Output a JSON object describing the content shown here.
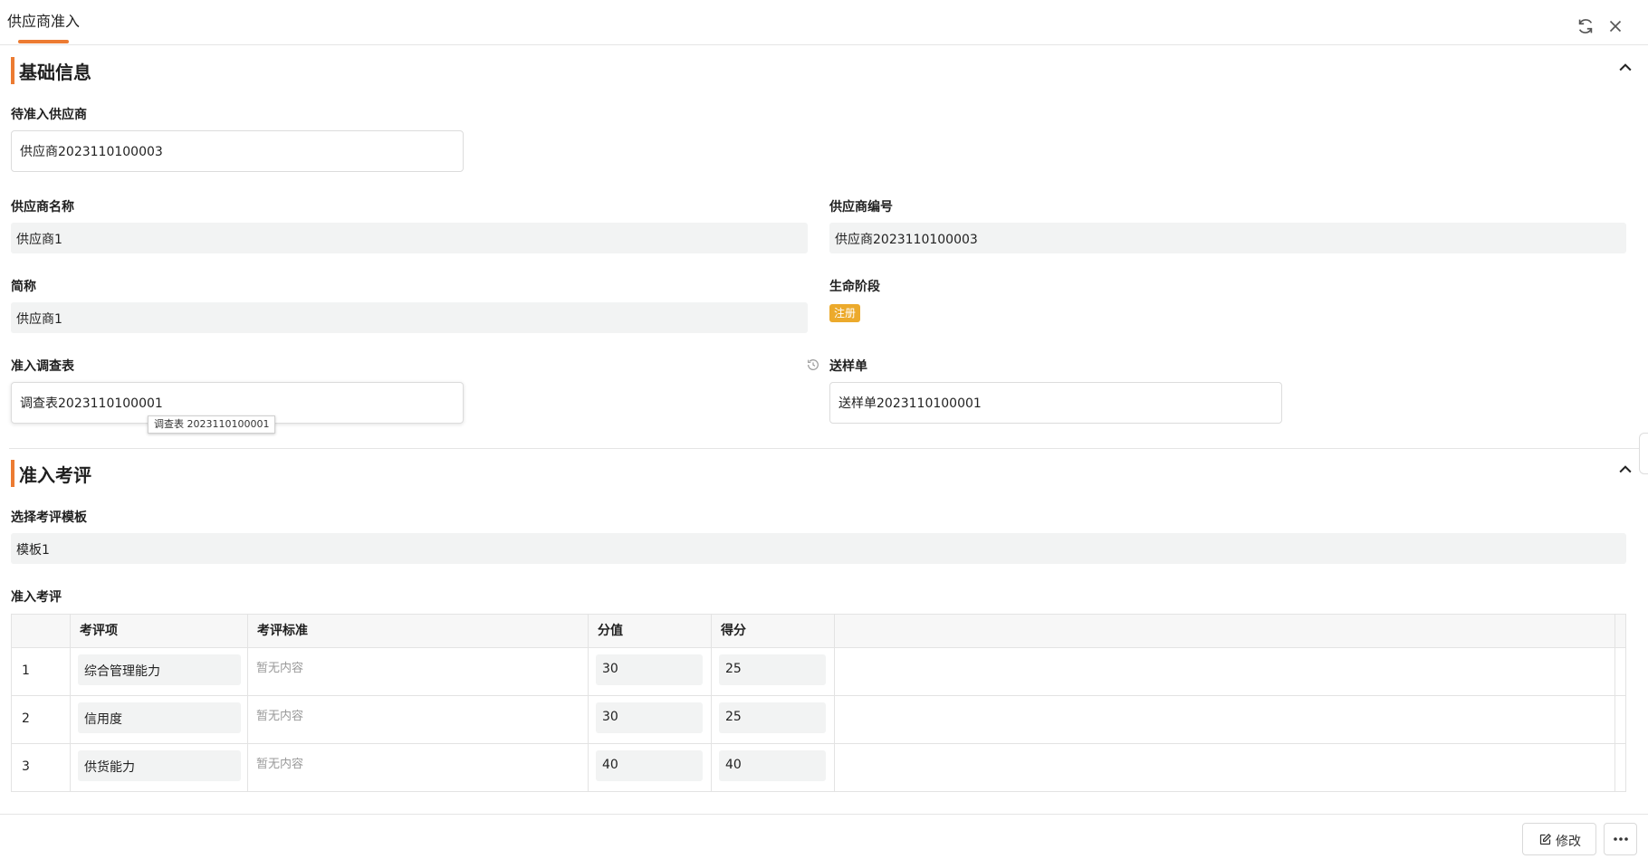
{
  "window": {
    "tab_title": "供应商准入"
  },
  "basic_section": {
    "title": "基础信息",
    "pending_supplier": {
      "label": "待准入供应商",
      "value": "供应商2023110100003"
    },
    "supplier_name": {
      "label": "供应商名称",
      "value": "供应商1"
    },
    "supplier_code": {
      "label": "供应商编号",
      "value": "供应商2023110100003"
    },
    "short_name": {
      "label": "简称",
      "value": "供应商1"
    },
    "lifecycle": {
      "label": "生命阶段",
      "value": "注册"
    },
    "survey": {
      "label": "准入调查表",
      "value": "调查表2023110100001",
      "tooltip": "调查表 2023110100001"
    },
    "sample": {
      "label": "送样单",
      "value": "送样单2023110100001"
    }
  },
  "eval_section": {
    "title": "准入考评",
    "template": {
      "label": "选择考评模板",
      "value": "模板1"
    },
    "table_label": "准入考评",
    "columns": [
      "考评项",
      "考评标准",
      "分值",
      "得分"
    ],
    "rows": [
      {
        "index": "1",
        "item": "综合管理能力",
        "standard": "暂无内容",
        "score_value": "30",
        "score": "25"
      },
      {
        "index": "2",
        "item": "信用度",
        "standard": "暂无内容",
        "score_value": "30",
        "score": "25"
      },
      {
        "index": "3",
        "item": "供货能力",
        "standard": "暂无内容",
        "score_value": "40",
        "score": "40"
      }
    ]
  },
  "footer": {
    "edit_label": "修改",
    "more_label": "···"
  },
  "colors": {
    "accent": "#ec7b32",
    "badge": "#ecaa2c"
  },
  "icons": [
    "refresh-icon",
    "close-icon",
    "chevron-up-icon",
    "history-icon",
    "edit-icon",
    "more-icon"
  ]
}
